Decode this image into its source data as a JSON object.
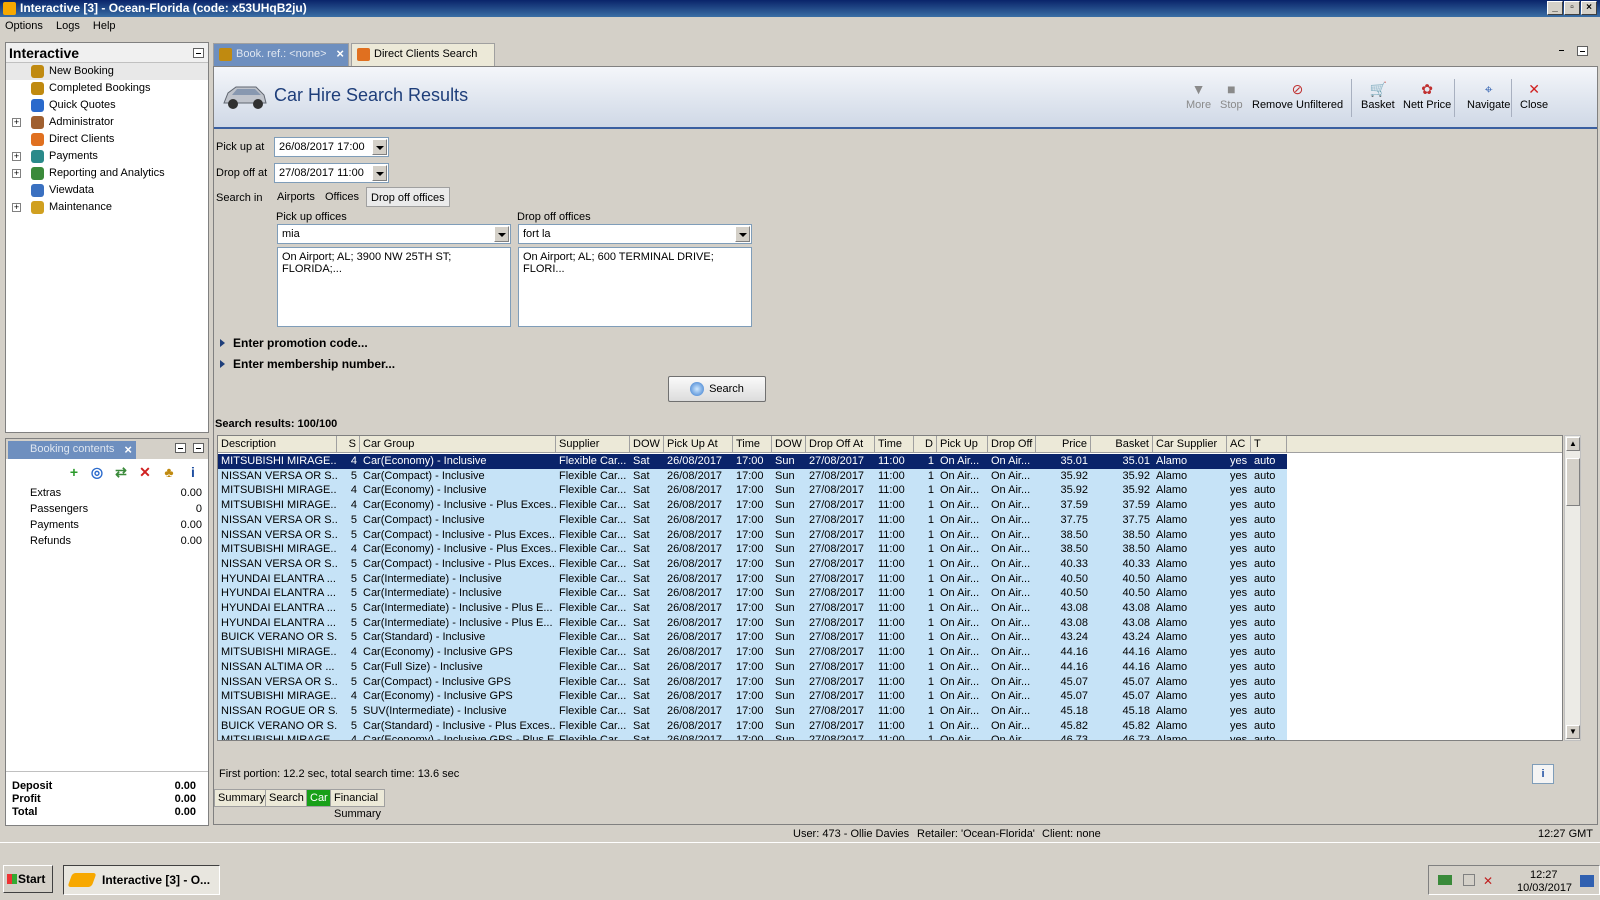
{
  "window": {
    "title": "Interactive [3] - Ocean-Florida (code: x53UHqB2ju)"
  },
  "menu": [
    "Options",
    "Logs",
    "Help"
  ],
  "left_panel": {
    "title": "Interactive",
    "items": [
      {
        "label": "New Booking",
        "expandable": false,
        "icon": "palm-icon"
      },
      {
        "label": "Completed Bookings",
        "expandable": false,
        "icon": "palm-icon"
      },
      {
        "label": "Quick Quotes",
        "expandable": false,
        "icon": "clock-icon"
      },
      {
        "label": "Administrator",
        "expandable": true,
        "icon": "person-icon"
      },
      {
        "label": "Direct Clients",
        "expandable": false,
        "icon": "umbrella-icon"
      },
      {
        "label": "Payments",
        "expandable": true,
        "icon": "payments-icon"
      },
      {
        "label": "Reporting and Analytics",
        "expandable": true,
        "icon": "report-icon"
      },
      {
        "label": "Viewdata",
        "expandable": false,
        "icon": "globe-icon"
      },
      {
        "label": "Maintenance",
        "expandable": true,
        "icon": "tools-icon"
      }
    ]
  },
  "booking_contents": {
    "tab_label": "Booking contents",
    "rows": [
      {
        "label": "Extras",
        "value": "0.00"
      },
      {
        "label": "Passengers",
        "value": "0"
      },
      {
        "label": "Payments",
        "value": "0.00"
      },
      {
        "label": "Refunds",
        "value": "0.00"
      }
    ],
    "totals": [
      {
        "label": "Deposit",
        "value": "0.00"
      },
      {
        "label": "Profit",
        "value": "0.00"
      },
      {
        "label": "Total",
        "value": "0.00"
      }
    ]
  },
  "tabs": [
    {
      "label": "Book. ref.: <none>",
      "active": true
    },
    {
      "label": "Direct Clients Search",
      "active": false
    }
  ],
  "header": {
    "title": "Car Hire Search Results",
    "toolbar": [
      {
        "label": "More",
        "icon": "down-arrow-icon",
        "disabled": true
      },
      {
        "label": "Stop",
        "icon": "stop-icon",
        "disabled": true
      },
      {
        "label": "Remove Unfiltered",
        "icon": "remove-unfiltered-icon",
        "disabled": false
      },
      {
        "label": "Basket",
        "icon": "basket-icon",
        "disabled": false
      },
      {
        "label": "Nett Price",
        "icon": "nett-price-icon",
        "disabled": false
      },
      {
        "label": "Navigate",
        "icon": "navigate-icon",
        "disabled": false
      },
      {
        "label": "Close",
        "icon": "close-icon",
        "disabled": false
      }
    ]
  },
  "form": {
    "pickup_label": "Pick up at",
    "pickup_value": "26/08/2017 17:00",
    "dropoff_label": "Drop off at",
    "dropoff_value": "27/08/2017 11:00",
    "search_in_label": "Search in",
    "search_in_options": [
      "Airports",
      "Offices",
      "Drop off offices"
    ],
    "search_in_selected": "Drop off offices",
    "pickup_offices_label": "Pick up offices",
    "pickup_offices_value": "mia",
    "pickup_offices_list": [
      "On Airport; AL; 3900 NW 25TH ST; FLORIDA;..."
    ],
    "dropoff_offices_label": "Drop off offices",
    "dropoff_offices_value": "fort la",
    "dropoff_offices_list": [
      "On Airport; AL; 600 TERMINAL DRIVE; FLORI..."
    ],
    "promo_label": "Enter promotion code...",
    "membership_label": "Enter membership number...",
    "search_button": "Search"
  },
  "results": {
    "count_label": "Search results: 100/100",
    "columns": [
      "Description",
      "S",
      "Car Group",
      "Supplier",
      "DOW",
      "Pick Up At",
      "Time",
      "DOW",
      "Drop Off At",
      "Time",
      "D",
      "Pick Up",
      "Drop Off",
      "Price",
      "Basket",
      "Car Supplier",
      "AC",
      "T"
    ],
    "rows": [
      [
        "MITSUBISHI MIRAGE...",
        "4",
        "Car(Economy) - Inclusive",
        "Flexible Car...",
        "Sat",
        "26/08/2017",
        "17:00",
        "Sun",
        "27/08/2017",
        "11:00",
        "1",
        "On Air...",
        "On Air...",
        "35.01",
        "35.01",
        "Alamo",
        "yes",
        "auto"
      ],
      [
        "NISSAN VERSA OR S...",
        "5",
        "Car(Compact) - Inclusive",
        "Flexible Car...",
        "Sat",
        "26/08/2017",
        "17:00",
        "Sun",
        "27/08/2017",
        "11:00",
        "1",
        "On Air...",
        "On Air...",
        "35.92",
        "35.92",
        "Alamo",
        "yes",
        "auto"
      ],
      [
        "MITSUBISHI MIRAGE...",
        "4",
        "Car(Economy) - Inclusive",
        "Flexible Car...",
        "Sat",
        "26/08/2017",
        "17:00",
        "Sun",
        "27/08/2017",
        "11:00",
        "1",
        "On Air...",
        "On Air...",
        "35.92",
        "35.92",
        "Alamo",
        "yes",
        "auto"
      ],
      [
        "MITSUBISHI MIRAGE...",
        "4",
        "Car(Economy) - Inclusive - Plus Exces...",
        "Flexible Car...",
        "Sat",
        "26/08/2017",
        "17:00",
        "Sun",
        "27/08/2017",
        "11:00",
        "1",
        "On Air...",
        "On Air...",
        "37.59",
        "37.59",
        "Alamo",
        "yes",
        "auto"
      ],
      [
        "NISSAN VERSA OR S...",
        "5",
        "Car(Compact) - Inclusive",
        "Flexible Car...",
        "Sat",
        "26/08/2017",
        "17:00",
        "Sun",
        "27/08/2017",
        "11:00",
        "1",
        "On Air...",
        "On Air...",
        "37.75",
        "37.75",
        "Alamo",
        "yes",
        "auto"
      ],
      [
        "NISSAN VERSA OR S...",
        "5",
        "Car(Compact) - Inclusive - Plus Exces...",
        "Flexible Car...",
        "Sat",
        "26/08/2017",
        "17:00",
        "Sun",
        "27/08/2017",
        "11:00",
        "1",
        "On Air...",
        "On Air...",
        "38.50",
        "38.50",
        "Alamo",
        "yes",
        "auto"
      ],
      [
        "MITSUBISHI MIRAGE...",
        "4",
        "Car(Economy) - Inclusive - Plus Exces...",
        "Flexible Car...",
        "Sat",
        "26/08/2017",
        "17:00",
        "Sun",
        "27/08/2017",
        "11:00",
        "1",
        "On Air...",
        "On Air...",
        "38.50",
        "38.50",
        "Alamo",
        "yes",
        "auto"
      ],
      [
        "NISSAN VERSA OR S...",
        "5",
        "Car(Compact) - Inclusive - Plus Exces...",
        "Flexible Car...",
        "Sat",
        "26/08/2017",
        "17:00",
        "Sun",
        "27/08/2017",
        "11:00",
        "1",
        "On Air...",
        "On Air...",
        "40.33",
        "40.33",
        "Alamo",
        "yes",
        "auto"
      ],
      [
        "HYUNDAI ELANTRA ...",
        "5",
        "Car(Intermediate) - Inclusive",
        "Flexible Car...",
        "Sat",
        "26/08/2017",
        "17:00",
        "Sun",
        "27/08/2017",
        "11:00",
        "1",
        "On Air...",
        "On Air...",
        "40.50",
        "40.50",
        "Alamo",
        "yes",
        "auto"
      ],
      [
        "HYUNDAI ELANTRA ...",
        "5",
        "Car(Intermediate) - Inclusive",
        "Flexible Car...",
        "Sat",
        "26/08/2017",
        "17:00",
        "Sun",
        "27/08/2017",
        "11:00",
        "1",
        "On Air...",
        "On Air...",
        "40.50",
        "40.50",
        "Alamo",
        "yes",
        "auto"
      ],
      [
        "HYUNDAI ELANTRA ...",
        "5",
        "Car(Intermediate) - Inclusive - Plus E...",
        "Flexible Car...",
        "Sat",
        "26/08/2017",
        "17:00",
        "Sun",
        "27/08/2017",
        "11:00",
        "1",
        "On Air...",
        "On Air...",
        "43.08",
        "43.08",
        "Alamo",
        "yes",
        "auto"
      ],
      [
        "HYUNDAI ELANTRA ...",
        "5",
        "Car(Intermediate) - Inclusive - Plus E...",
        "Flexible Car...",
        "Sat",
        "26/08/2017",
        "17:00",
        "Sun",
        "27/08/2017",
        "11:00",
        "1",
        "On Air...",
        "On Air...",
        "43.08",
        "43.08",
        "Alamo",
        "yes",
        "auto"
      ],
      [
        "BUICK VERANO OR S...",
        "5",
        "Car(Standard) - Inclusive",
        "Flexible Car...",
        "Sat",
        "26/08/2017",
        "17:00",
        "Sun",
        "27/08/2017",
        "11:00",
        "1",
        "On Air...",
        "On Air...",
        "43.24",
        "43.24",
        "Alamo",
        "yes",
        "auto"
      ],
      [
        "MITSUBISHI MIRAGE...",
        "4",
        "Car(Economy) - Inclusive GPS",
        "Flexible Car...",
        "Sat",
        "26/08/2017",
        "17:00",
        "Sun",
        "27/08/2017",
        "11:00",
        "1",
        "On Air...",
        "On Air...",
        "44.16",
        "44.16",
        "Alamo",
        "yes",
        "auto"
      ],
      [
        "NISSAN ALTIMA OR ...",
        "5",
        "Car(Full Size) - Inclusive",
        "Flexible Car...",
        "Sat",
        "26/08/2017",
        "17:00",
        "Sun",
        "27/08/2017",
        "11:00",
        "1",
        "On Air...",
        "On Air...",
        "44.16",
        "44.16",
        "Alamo",
        "yes",
        "auto"
      ],
      [
        "NISSAN VERSA OR S...",
        "5",
        "Car(Compact) - Inclusive GPS",
        "Flexible Car...",
        "Sat",
        "26/08/2017",
        "17:00",
        "Sun",
        "27/08/2017",
        "11:00",
        "1",
        "On Air...",
        "On Air...",
        "45.07",
        "45.07",
        "Alamo",
        "yes",
        "auto"
      ],
      [
        "MITSUBISHI MIRAGE...",
        "4",
        "Car(Economy) - Inclusive GPS",
        "Flexible Car...",
        "Sat",
        "26/08/2017",
        "17:00",
        "Sun",
        "27/08/2017",
        "11:00",
        "1",
        "On Air...",
        "On Air...",
        "45.07",
        "45.07",
        "Alamo",
        "yes",
        "auto"
      ],
      [
        "NISSAN ROGUE OR S...",
        "5",
        "SUV(Intermediate) - Inclusive",
        "Flexible Car...",
        "Sat",
        "26/08/2017",
        "17:00",
        "Sun",
        "27/08/2017",
        "11:00",
        "1",
        "On Air...",
        "On Air...",
        "45.18",
        "45.18",
        "Alamo",
        "yes",
        "auto"
      ],
      [
        "BUICK VERANO OR S...",
        "5",
        "Car(Standard) - Inclusive - Plus Exces...",
        "Flexible Car...",
        "Sat",
        "26/08/2017",
        "17:00",
        "Sun",
        "27/08/2017",
        "11:00",
        "1",
        "On Air...",
        "On Air...",
        "45.82",
        "45.82",
        "Alamo",
        "yes",
        "auto"
      ],
      [
        "MITSUBISHI MIRAGE...",
        "4",
        "Car(Economy) - Inclusive GPS - Plus E...",
        "Flexible Car...",
        "Sat",
        "26/08/2017",
        "17:00",
        "Sun",
        "27/08/2017",
        "11:00",
        "1",
        "On Air...",
        "On Air...",
        "46.73",
        "46.73",
        "Alamo",
        "yes",
        "auto"
      ]
    ],
    "timing": "First portion: 12.2 sec, total search time: 13.6 sec"
  },
  "bottom_tabs": [
    "Summary",
    "Search",
    "Car",
    "Financial Summary"
  ],
  "bottom_tab_active": "Car",
  "status": {
    "user": "User: 473 - Ollie Davies",
    "retailer": "Retailer: 'Ocean-Florida'",
    "client": "Client: none",
    "time": "12:27 GMT"
  },
  "taskbar": {
    "start": "Start",
    "task": "Interactive [3] - O...",
    "clock_time": "12:27",
    "clock_date": "10/03/2017"
  }
}
